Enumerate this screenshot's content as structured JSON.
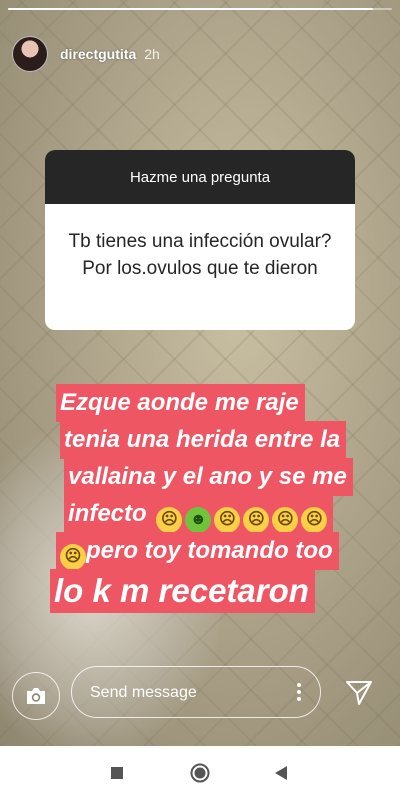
{
  "story": {
    "progress": 0.95,
    "username": "directgutita",
    "time_ago": "2h"
  },
  "question_sticker": {
    "header": "Hazme una pregunta",
    "question": "Tb tienes una infección ovular? Por los.ovulos que te dieron"
  },
  "caption": {
    "lines": [
      "Ezque aonde me raje",
      "tenia una herida entre la",
      "vallaina y el ano y se me",
      "infecto",
      "pero toy tomando too",
      "lo k m recetaron"
    ],
    "emojis": [
      "confused-face",
      "frog-face",
      "confused-face",
      "confused-face",
      "confused-face",
      "confused-face",
      "confused-face"
    ]
  },
  "reply_bar": {
    "placeholder": "Send message"
  },
  "colors": {
    "caption_highlight": "#ef5664",
    "sticker_header_bg": "#262626",
    "nav_bar_bg": "#ffffff"
  }
}
